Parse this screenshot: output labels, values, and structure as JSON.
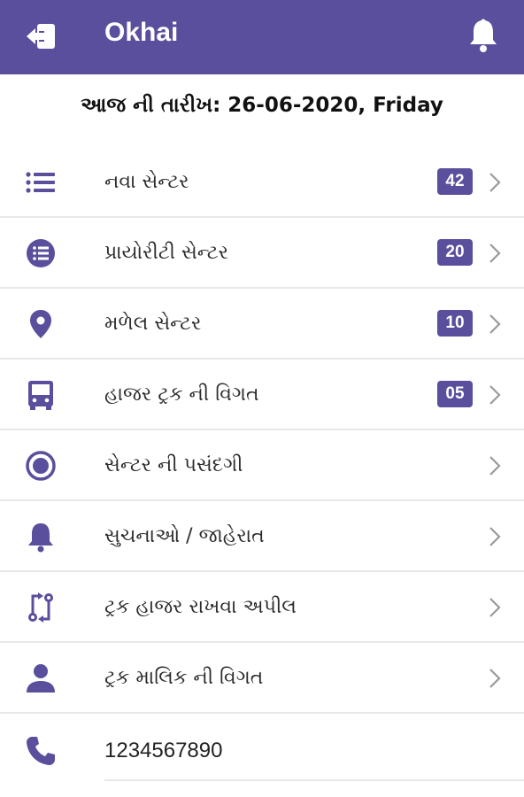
{
  "colors": {
    "primary": "#5a4f9c",
    "divider": "#e8e8e8",
    "icon": "#5a4f9c"
  },
  "appbar": {
    "title": "Okhai",
    "back_icon": "logout-icon",
    "bell_icon": "bell-icon"
  },
  "date_line": "આજ ની તારીખ: 26-06-2020, Friday",
  "menu": {
    "items": [
      {
        "label": "નવા સેન્ટર",
        "badge": "42",
        "icon": "list-icon"
      },
      {
        "label": "પ્રાયોરીટી સેન્ટર",
        "badge": "20",
        "icon": "list-circle-icon"
      },
      {
        "label": "મળેલ સેન્ટર",
        "badge": "10",
        "icon": "location-pin-icon"
      },
      {
        "label": "હાજર ટ્રક ની વિગત",
        "badge": "05",
        "icon": "bus-icon"
      },
      {
        "label": "સેન્ટર ની પસંદગી",
        "badge": "",
        "icon": "radio-circle-icon"
      },
      {
        "label": "સુચનાઓ / જાહેરાત",
        "badge": "",
        "icon": "bell-icon"
      },
      {
        "label": "ટ્રક હાજર રાખવા અપીલ",
        "badge": "",
        "icon": "swap-route-icon"
      },
      {
        "label": "ટ્રક માલિક ની વિગત",
        "badge": "",
        "icon": "person-icon"
      }
    ]
  },
  "contact": {
    "phone": "1234567890",
    "icon": "phone-icon"
  }
}
